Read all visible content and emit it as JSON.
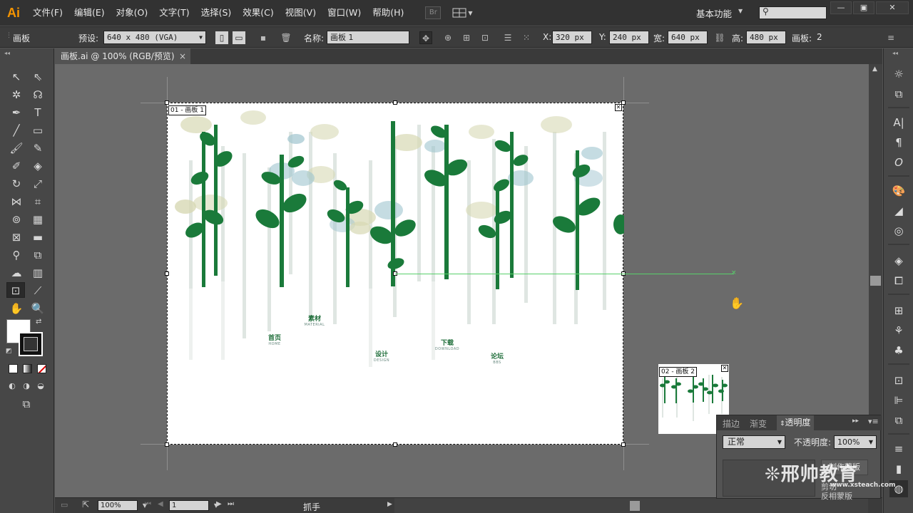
{
  "app": {
    "logo": "Ai"
  },
  "menu": [
    "文件(F)",
    "编辑(E)",
    "对象(O)",
    "文字(T)",
    "选择(S)",
    "效果(C)",
    "视图(V)",
    "窗口(W)",
    "帮助(H)"
  ],
  "bridge_label": "Br",
  "workspace": {
    "label": "基本功能",
    "search_icon": "search-icon"
  },
  "window_controls": [
    "minimize-icon",
    "maximize-icon",
    "close-icon"
  ],
  "control_bar": {
    "tool_name": "画板",
    "preset_label": "预设:",
    "preset_value": "640 x 480 (VGA)",
    "name_label": "名称:",
    "name_value": "画板 1",
    "x_label": "X:",
    "x_value": "320 px",
    "y_label": "Y:",
    "y_value": "240 px",
    "w_label": "宽:",
    "w_value": "640 px",
    "h_label": "高:",
    "h_value": "480 px",
    "artboards_label": "画板:",
    "artboards_value": "2"
  },
  "document": {
    "tab_title": "画板.ai @ 100% (RGB/预览)",
    "close": "×"
  },
  "artboards": [
    {
      "label": "01 - 画板 1"
    },
    {
      "label": "02 - 画板 2"
    }
  ],
  "artwork_nav": [
    {
      "cn": "首页",
      "en": "HOME"
    },
    {
      "cn": "素材",
      "en": "MATERIAL"
    },
    {
      "cn": "设计",
      "en": "DESIGN"
    },
    {
      "cn": "下载",
      "en": "DOWNLOAD"
    },
    {
      "cn": "论坛",
      "en": "BBS"
    }
  ],
  "status": {
    "zoom": "100%",
    "page": "1",
    "tool": "抓手"
  },
  "transparency_panel": {
    "tabs": [
      "描边",
      "渐变",
      "透明度"
    ],
    "active_tab": "透明度",
    "mode": "正常",
    "opacity_label": "不透明度:",
    "opacity_value": "100%",
    "make_mask": "制作蒙版",
    "clip": "剪切",
    "invert": "反相蒙版"
  },
  "watermark": {
    "brand": "邢帅教育",
    "url": "www.xsteach.com"
  },
  "colors": {
    "dark_green": "#1a7a3a",
    "mid_green": "#2e8b4c",
    "pale_blue": "#9fc4cf",
    "pale_olive": "#d7d8b4",
    "pale_stem": "#dfe6e2",
    "ui_dark": "#323232",
    "ui_mid": "#535353",
    "logo_orange": "#f79500"
  }
}
